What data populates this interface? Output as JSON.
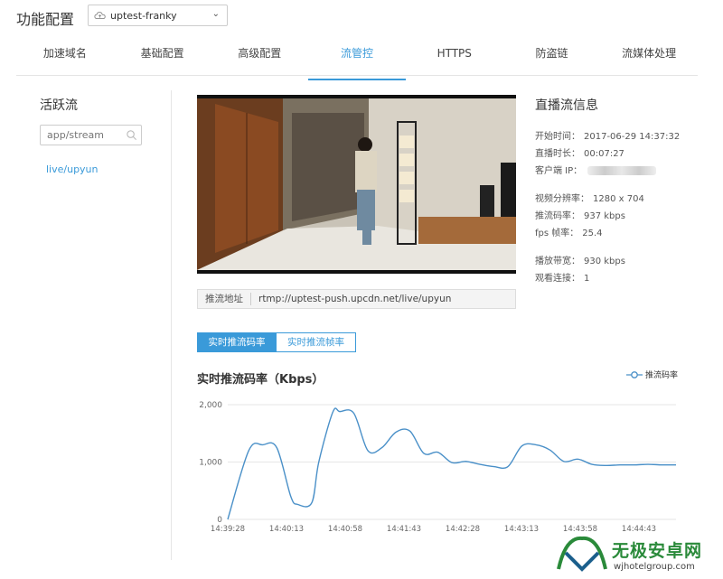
{
  "header": {
    "title": "功能配置",
    "domain_select": "uptest-franky"
  },
  "tabs": [
    "加速域名",
    "基础配置",
    "高级配置",
    "流管控",
    "HTTPS",
    "防盗链",
    "流媒体处理"
  ],
  "left_panel": {
    "title": "活跃流",
    "search_placeholder": "app/stream",
    "streams": [
      "live/upyun"
    ]
  },
  "push": {
    "label": "推流地址",
    "url": "rtmp://uptest-push.upcdn.net/live/upyun"
  },
  "info": {
    "title": "直播流信息",
    "start_label": "开始时间：",
    "start_value": "2017-06-29 14:37:32",
    "duration_label": "直播时长：",
    "duration_value": "00:07:27",
    "client_label": "客户端 IP：",
    "resolution_label": "视频分辨率：",
    "resolution_value": "1280 x 704",
    "bitrate_label": "推流码率：",
    "bitrate_value": "937 kbps",
    "fps_label": "fps 帧率：",
    "fps_value": "25.4",
    "bandwidth_label": "播放带宽：",
    "bandwidth_value": "930 kbps",
    "connections_label": "观看连接：",
    "connections_value": "1"
  },
  "segment": {
    "active": "实时推流码率",
    "inactive": "实时推流帧率"
  },
  "chart_title": "实时推流码率（Kbps）",
  "watermark": {
    "name": "无极安卓网",
    "url": "wjhotelgroup.com"
  },
  "colors": {
    "accent": "#3a9ad9",
    "line": "#4a90c8",
    "watermark_green": "#2a8a3a"
  },
  "chart_data": {
    "type": "line",
    "title": "实时推流码率（Kbps）",
    "xlabel": "",
    "ylabel": "",
    "ylim": [
      0,
      2000
    ],
    "yticks": [
      "0",
      "1,000",
      "2,000"
    ],
    "xticks": [
      "14:39:28",
      "14:40:13",
      "14:40:58",
      "14:41:43",
      "14:42:28",
      "14:43:13",
      "14:43:58",
      "14:44:43"
    ],
    "legend_position": "top-right",
    "series": [
      {
        "name": "推流码率",
        "x": [
          0,
          3,
          5,
          7,
          9,
          10,
          12,
          13,
          15,
          16,
          18,
          20,
          22,
          24,
          26,
          28,
          30,
          32,
          34,
          36,
          38,
          40,
          42,
          44,
          46,
          48,
          50,
          52,
          54,
          56,
          58,
          60,
          62,
          64
        ],
        "values": [
          0,
          1200,
          1300,
          1250,
          400,
          260,
          290,
          1000,
          1870,
          1880,
          1850,
          1200,
          1250,
          1520,
          1540,
          1150,
          1170,
          990,
          1010,
          960,
          920,
          920,
          1280,
          1300,
          1210,
          1010,
          1050,
          960,
          940,
          950,
          950,
          960,
          950,
          950
        ]
      }
    ]
  }
}
